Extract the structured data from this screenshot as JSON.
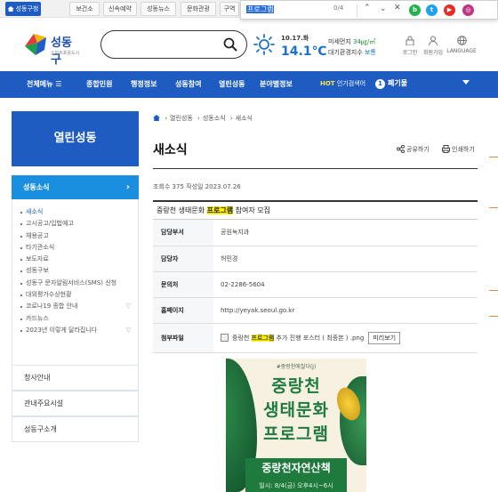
{
  "topbar": {
    "tabs": [
      "성동구청",
      "보건소",
      "신속예약",
      "성동뉴스",
      "문화관광",
      "구역"
    ]
  },
  "findbar": {
    "query": "프로그램",
    "count": "0/4"
  },
  "social": [
    {
      "name": "blog-icon",
      "letter": "b",
      "color": "#21b24b"
    },
    {
      "name": "twitter-icon",
      "letter": "t",
      "color": "#1da1f2"
    },
    {
      "name": "youtube-icon",
      "letter": "▶",
      "color": "#e52d27"
    },
    {
      "name": "instagram-icon",
      "letter": "◎",
      "color": "#c13584"
    }
  ],
  "header": {
    "logo_name": "성동구",
    "logo_tag": "스마트포용도시",
    "date": "10.17.화",
    "temp": "14.1℃",
    "air_label_1": "미세먼지",
    "air_value_1": "34㎍/㎥",
    "air_label_2": "대기환경지수",
    "air_value_2": "보통",
    "util": [
      "로그인",
      "회원가입",
      "LANGUAGE"
    ]
  },
  "nav": {
    "all": "전체메뉴 ☰",
    "items": [
      "종합민원",
      "행정정보",
      "성동참여",
      "열린성동",
      "분야별정보"
    ],
    "hot_label": "HOT",
    "hot_text": " 인기검색어",
    "kw_num": "1",
    "kw": "폐기물"
  },
  "sidebar": {
    "title": "열린성동",
    "active": "성동소식",
    "active_arrow": "›",
    "submenu": [
      "새소식",
      "고시공고/입법예고",
      "채용공고",
      "타기관소식",
      "보도자료",
      "성동구보",
      "성동구 문자알림서비스(SMS) 신청",
      "대외평가수상현황",
      "코로나19 종합 안내",
      "카드뉴스",
      "2023년 이렇게 달라집니다"
    ],
    "links": [
      "청사안내",
      "관내주요시설",
      "성동구소개"
    ]
  },
  "content": {
    "breadcrumb": [
      "열린성동",
      "성동소식",
      "새소식"
    ],
    "title": "새소식",
    "share": "공유하기",
    "print": "인쇄하기",
    "meta": "조회수 375 작성일 2023.07.26",
    "post_title_pre": "중랑천 생태문화 ",
    "post_title_hl": "프로그램",
    "post_title_post": " 참여자 모집",
    "rows": [
      {
        "label": "담당부서",
        "value": "공원녹지과"
      },
      {
        "label": "담당자",
        "value": "허민경"
      },
      {
        "label": "문의처",
        "value": "02-2286-5604"
      },
      {
        "label": "홈페이지",
        "value": "http://yeyak.seoul.go.kr"
      }
    ],
    "file_label": "첨부파일",
    "file_pre": "중랑천 ",
    "file_hl": "프로그램",
    "file_post": " 추가 진행 포스터 ( 최종본 ) .png",
    "preview_btn": "미리보기"
  },
  "poster": {
    "sub": "#중랑천애칠다(J)",
    "line1": "중랑천",
    "line2": "생태문화",
    "line3": "프로그램",
    "band_title": "중랑천자연산책",
    "band_date": "일시: 8/4(금) 오후4시~6시"
  }
}
